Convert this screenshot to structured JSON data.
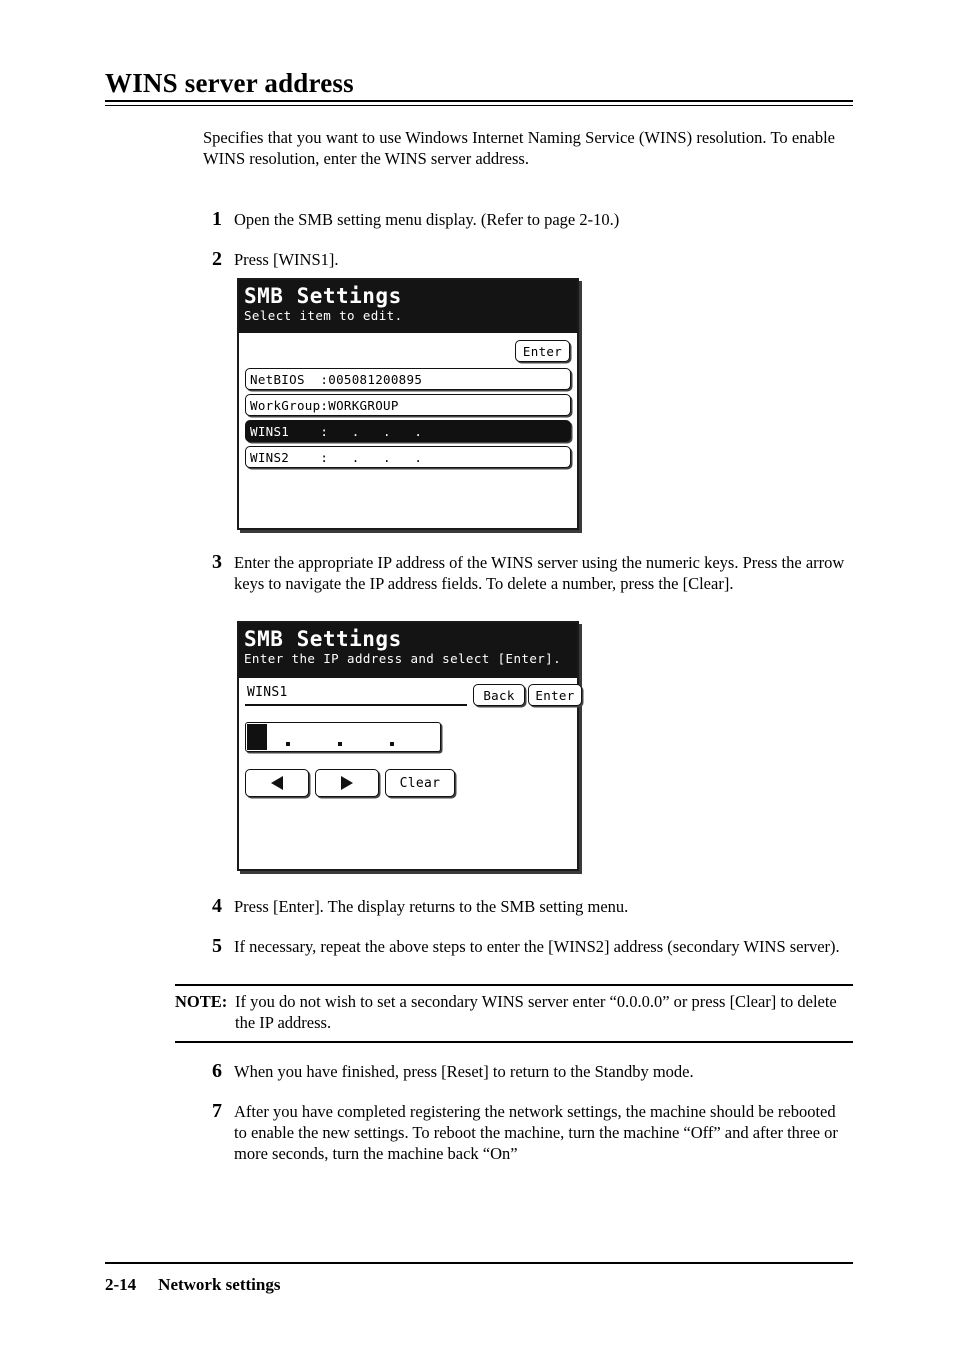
{
  "page": {
    "title": "WINS server address",
    "intro": "Specifies that you want to use Windows Internet Naming Service (WINS) resolution. To enable WINS resolution, enter the WINS server address."
  },
  "steps": [
    {
      "num": "1",
      "text": "Open the SMB setting menu display. (Refer to page 2-10.)"
    },
    {
      "num": "2",
      "text": "Press [WINS1]."
    },
    {
      "num": "3",
      "text": "Enter the appropriate IP address of the WINS server using the numeric keys. Press the arrow keys to navigate the IP address fields. To delete a number, press the [Clear]."
    },
    {
      "num": "4",
      "text": "Press [Enter]. The display returns to the SMB setting menu."
    },
    {
      "num": "5",
      "text": "If necessary, repeat the above steps to enter the [WINS2] address (secondary WINS server)."
    },
    {
      "num": "6",
      "text": "When you have finished, press [Reset] to return to the Standby mode."
    },
    {
      "num": "7",
      "text": "After you have completed registering the network settings, the machine should be rebooted to enable the new settings. To reboot the machine, turn the machine “Off” and after three or more seconds, turn the machine back “On”"
    }
  ],
  "note": {
    "label": "NOTE:",
    "text": "If you do not wish to set a secondary WINS server enter “0.0.0.0” or press [Clear] to delete the IP address."
  },
  "lcd1": {
    "title": "SMB Settings",
    "subtitle": "Select item to edit.",
    "enter_label": "Enter",
    "rows": [
      {
        "label": "NetBIOS  :005081200895",
        "selected": false
      },
      {
        "label": "WorkGroup:WORKGROUP",
        "selected": false
      },
      {
        "label": "WINS1    :   .   .   .",
        "selected": true
      },
      {
        "label": "WINS2    :   .   .   .",
        "selected": false
      }
    ]
  },
  "lcd2": {
    "title": "SMB Settings",
    "subtitle": "Enter the IP address and select [Enter].",
    "field_label": "WINS1",
    "back_label": "Back",
    "enter_label": "Enter",
    "clear_label": "Clear",
    "ip_value": ""
  },
  "footer": {
    "page_number": "2-14",
    "section": "Network settings"
  }
}
